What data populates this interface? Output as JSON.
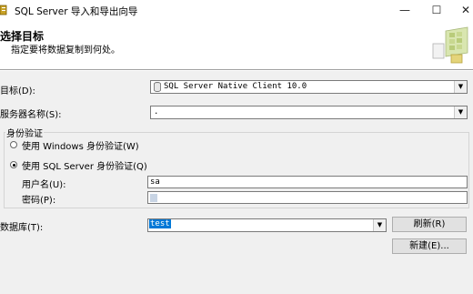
{
  "window": {
    "title": "SQL Server 导入和导出向导",
    "minimize_glyph": "—",
    "maximize_glyph": "☐",
    "close_glyph": "✕"
  },
  "header": {
    "title": "选择目标",
    "subtitle": "指定要将数据复制到何处。"
  },
  "form": {
    "destination": {
      "label": "目标(D):",
      "value": "SQL Server Native Client 10.0",
      "icon": "database-icon"
    },
    "server_name": {
      "label": "服务器名称(S):",
      "value": "."
    },
    "auth": {
      "group_title": "身份验证",
      "windows_option": "使用 Windows 身份验证(W)",
      "sql_option": "使用 SQL Server 身份验证(Q)",
      "selected": "sql",
      "username_label": "用户名(U):",
      "username_value": "sa",
      "password_label": "密码(P):",
      "password_value": ""
    },
    "database": {
      "label": "数据库(T):",
      "value": "test"
    }
  },
  "buttons": {
    "refresh": "刷新(R)",
    "new": "新建(E)..."
  },
  "colors": {
    "selection": "#0078d7",
    "panel_bg": "#f0f0f0"
  }
}
